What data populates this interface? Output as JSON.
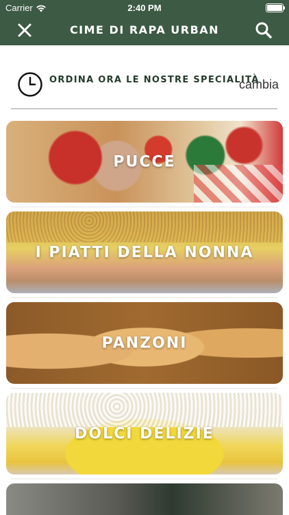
{
  "status_bar": {
    "carrier": "Carrier",
    "time": "2:40 PM",
    "wifi_icon": "wifi-icon",
    "battery_icon": "battery-icon",
    "battery_level": 1.0
  },
  "nav": {
    "title": "CIME DI RAPA URBAN",
    "close_icon": "close-icon",
    "search_icon": "search-icon",
    "background": "#3d5a44"
  },
  "order": {
    "icon": "clock-icon",
    "heading": "ORDINA ORA LE NOSTRE SPECIALITÀ",
    "change_label": "cambia"
  },
  "categories": [
    {
      "label": "PUCCE"
    },
    {
      "label": "I PIATTI DELLA NONNA"
    },
    {
      "label": "PANZONI"
    },
    {
      "label": "DOLCI DELIZIE"
    },
    {
      "label": ""
    }
  ]
}
